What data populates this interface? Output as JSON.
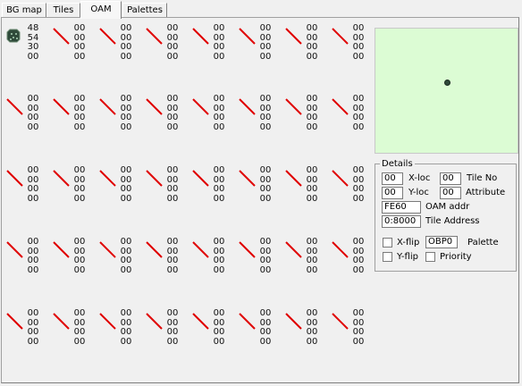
{
  "tabs": [
    {
      "label": "BG map",
      "active": false
    },
    {
      "label": "Tiles",
      "active": false
    },
    {
      "label": "OAM",
      "active": true
    },
    {
      "label": "Palettes",
      "active": false
    }
  ],
  "sprites": [
    {
      "values": [
        "48",
        "54",
        "30",
        "00"
      ],
      "icon": "sprite-tile-icon"
    },
    {
      "values": [
        "00",
        "00",
        "00",
        "00"
      ],
      "icon": "empty-sprite-icon"
    },
    {
      "values": [
        "00",
        "00",
        "00",
        "00"
      ],
      "icon": "empty-sprite-icon"
    },
    {
      "values": [
        "00",
        "00",
        "00",
        "00"
      ],
      "icon": "empty-sprite-icon"
    },
    {
      "values": [
        "00",
        "00",
        "00",
        "00"
      ],
      "icon": "empty-sprite-icon"
    },
    {
      "values": [
        "00",
        "00",
        "00",
        "00"
      ],
      "icon": "empty-sprite-icon"
    },
    {
      "values": [
        "00",
        "00",
        "00",
        "00"
      ],
      "icon": "empty-sprite-icon"
    },
    {
      "values": [
        "00",
        "00",
        "00",
        "00"
      ],
      "icon": "empty-sprite-icon"
    },
    {
      "values": [
        "00",
        "00",
        "00",
        "00"
      ],
      "icon": "empty-sprite-icon"
    },
    {
      "values": [
        "00",
        "00",
        "00",
        "00"
      ],
      "icon": "empty-sprite-icon"
    },
    {
      "values": [
        "00",
        "00",
        "00",
        "00"
      ],
      "icon": "empty-sprite-icon"
    },
    {
      "values": [
        "00",
        "00",
        "00",
        "00"
      ],
      "icon": "empty-sprite-icon"
    },
    {
      "values": [
        "00",
        "00",
        "00",
        "00"
      ],
      "icon": "empty-sprite-icon"
    },
    {
      "values": [
        "00",
        "00",
        "00",
        "00"
      ],
      "icon": "empty-sprite-icon"
    },
    {
      "values": [
        "00",
        "00",
        "00",
        "00"
      ],
      "icon": "empty-sprite-icon"
    },
    {
      "values": [
        "00",
        "00",
        "00",
        "00"
      ],
      "icon": "empty-sprite-icon"
    },
    {
      "values": [
        "00",
        "00",
        "00",
        "00"
      ],
      "icon": "empty-sprite-icon"
    },
    {
      "values": [
        "00",
        "00",
        "00",
        "00"
      ],
      "icon": "empty-sprite-icon"
    },
    {
      "values": [
        "00",
        "00",
        "00",
        "00"
      ],
      "icon": "empty-sprite-icon"
    },
    {
      "values": [
        "00",
        "00",
        "00",
        "00"
      ],
      "icon": "empty-sprite-icon"
    },
    {
      "values": [
        "00",
        "00",
        "00",
        "00"
      ],
      "icon": "empty-sprite-icon"
    },
    {
      "values": [
        "00",
        "00",
        "00",
        "00"
      ],
      "icon": "empty-sprite-icon"
    },
    {
      "values": [
        "00",
        "00",
        "00",
        "00"
      ],
      "icon": "empty-sprite-icon"
    },
    {
      "values": [
        "00",
        "00",
        "00",
        "00"
      ],
      "icon": "empty-sprite-icon"
    },
    {
      "values": [
        "00",
        "00",
        "00",
        "00"
      ],
      "icon": "empty-sprite-icon"
    },
    {
      "values": [
        "00",
        "00",
        "00",
        "00"
      ],
      "icon": "empty-sprite-icon"
    },
    {
      "values": [
        "00",
        "00",
        "00",
        "00"
      ],
      "icon": "empty-sprite-icon"
    },
    {
      "values": [
        "00",
        "00",
        "00",
        "00"
      ],
      "icon": "empty-sprite-icon"
    },
    {
      "values": [
        "00",
        "00",
        "00",
        "00"
      ],
      "icon": "empty-sprite-icon"
    },
    {
      "values": [
        "00",
        "00",
        "00",
        "00"
      ],
      "icon": "empty-sprite-icon"
    },
    {
      "values": [
        "00",
        "00",
        "00",
        "00"
      ],
      "icon": "empty-sprite-icon"
    },
    {
      "values": [
        "00",
        "00",
        "00",
        "00"
      ],
      "icon": "empty-sprite-icon"
    },
    {
      "values": [
        "00",
        "00",
        "00",
        "00"
      ],
      "icon": "empty-sprite-icon"
    },
    {
      "values": [
        "00",
        "00",
        "00",
        "00"
      ],
      "icon": "empty-sprite-icon"
    },
    {
      "values": [
        "00",
        "00",
        "00",
        "00"
      ],
      "icon": "empty-sprite-icon"
    },
    {
      "values": [
        "00",
        "00",
        "00",
        "00"
      ],
      "icon": "empty-sprite-icon"
    },
    {
      "values": [
        "00",
        "00",
        "00",
        "00"
      ],
      "icon": "empty-sprite-icon"
    },
    {
      "values": [
        "00",
        "00",
        "00",
        "00"
      ],
      "icon": "empty-sprite-icon"
    },
    {
      "values": [
        "00",
        "00",
        "00",
        "00"
      ],
      "icon": "empty-sprite-icon"
    },
    {
      "values": [
        "00",
        "00",
        "00",
        "00"
      ],
      "icon": "empty-sprite-icon"
    }
  ],
  "preview": {
    "background": "#dcfcd4",
    "marker_icon": "sprite-position-dot-icon"
  },
  "details": {
    "legend": "Details",
    "xloc": {
      "value": "00",
      "label": "X-loc"
    },
    "tileno": {
      "value": "00",
      "label": "Tile No"
    },
    "yloc": {
      "value": "00",
      "label": "Y-loc"
    },
    "attribute": {
      "value": "00",
      "label": "Attribute"
    },
    "oam_addr": {
      "value": "FE60",
      "label": "OAM addr"
    },
    "tile_address": {
      "value": "0:8000",
      "label": "Tile Address"
    },
    "xflip": {
      "label": "X-flip",
      "checked": false
    },
    "palette": {
      "value": "OBP0",
      "label": "Palette"
    },
    "yflip": {
      "label": "Y-flip",
      "checked": false
    },
    "priority": {
      "label": "Priority",
      "checked": false
    }
  },
  "colors": {
    "empty_slash": "#e00000",
    "preview_bg": "#dcfcd4"
  }
}
